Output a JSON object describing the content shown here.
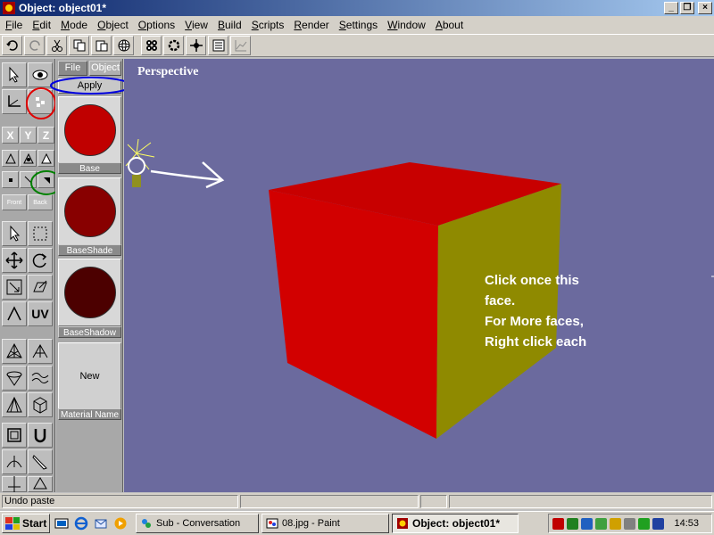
{
  "window": {
    "title": "Object: object01*"
  },
  "menu": [
    "File",
    "Edit",
    "Mode",
    "Object",
    "Options",
    "View",
    "Build",
    "Scripts",
    "Render",
    "Settings",
    "Window",
    "About"
  ],
  "toolbar_icons": [
    "undo-icon",
    "redo-icon",
    "cut-icon",
    "copy-icon",
    "paste-icon",
    "sphere-icon",
    "grid-icon",
    "circle-icon",
    "move-points-icon",
    "list-icon",
    "graph-icon"
  ],
  "palette": {
    "axis_x": "X",
    "axis_y": "Y",
    "axis_z": "Z",
    "front_label": "Front",
    "back_label": "Back",
    "uv_label": "UV"
  },
  "materials": {
    "tab_file": "File",
    "tab_object": "Object",
    "apply_label": "Apply",
    "items": [
      {
        "label": "Base",
        "color": "#c00000"
      },
      {
        "label": "BaseShade",
        "color": "#880000"
      },
      {
        "label": "BaseShadow",
        "color": "#4c0000"
      }
    ],
    "new_label": "New",
    "name_label": "Material Name"
  },
  "viewport": {
    "view_name": "Perspective",
    "background": "#6b6a9e",
    "front_face_color": "#d20000",
    "side_face_color": "#8f8a00",
    "instruction_lines": [
      "Click once this",
      "face.",
      "For More faces,",
      "Right click each"
    ]
  },
  "status": {
    "message": "Undo paste"
  },
  "taskbar": {
    "start_label": "Start",
    "tasks": [
      {
        "label": "Sub - Conversation",
        "active": false
      },
      {
        "label": "08.jpg - Paint",
        "active": false
      },
      {
        "label": "Object: object01*",
        "active": true
      }
    ],
    "clock": "14:53"
  },
  "annotation_colors": {
    "red": "#e00000",
    "blue": "#0000e0",
    "green": "#008000"
  }
}
